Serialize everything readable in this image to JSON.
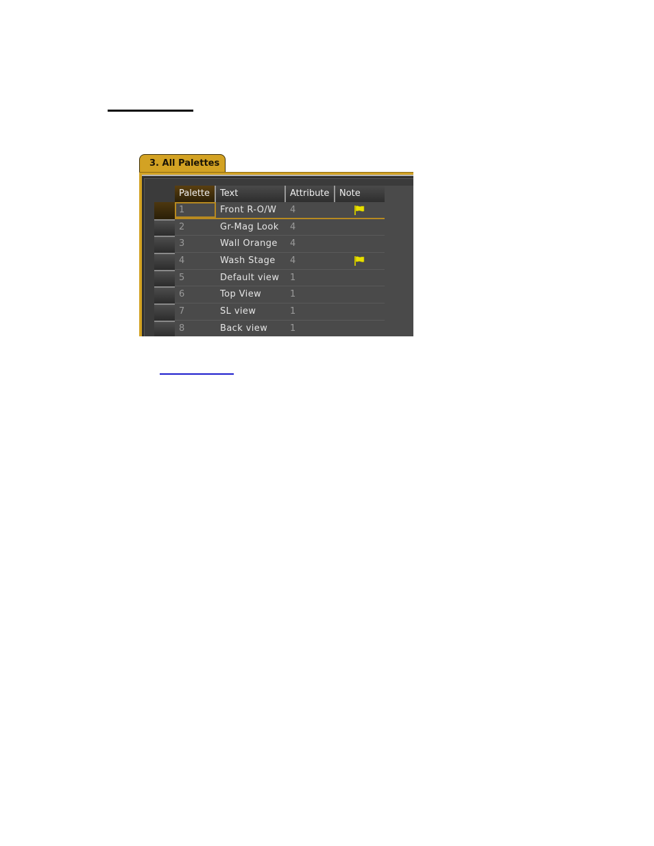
{
  "window": {
    "tab_label": "3. All Palettes"
  },
  "table": {
    "columns": [
      "Palette",
      "Text",
      "Attribute",
      "Note"
    ],
    "rows": [
      {
        "palette": "1",
        "text": "Front R-O/W",
        "attribute": "4",
        "note_icon": "flag-icon",
        "selected": true
      },
      {
        "palette": "2",
        "text": "Gr-Mag Look",
        "attribute": "4",
        "note_icon": null
      },
      {
        "palette": "3",
        "text": "Wall Orange",
        "attribute": "4",
        "note_icon": null
      },
      {
        "palette": "4",
        "text": "Wash Stage",
        "attribute": "4",
        "note_icon": "flag-icon"
      },
      {
        "palette": "5",
        "text": "Default view",
        "attribute": "1",
        "note_icon": null
      },
      {
        "palette": "6",
        "text": "Top View",
        "attribute": "1",
        "note_icon": null
      },
      {
        "palette": "7",
        "text": "SL view",
        "attribute": "1",
        "note_icon": null
      },
      {
        "palette": "8",
        "text": "Back view",
        "attribute": "1",
        "note_icon": null
      }
    ]
  },
  "colors": {
    "accent": "#d3a223",
    "flag": "#e8e000",
    "link": "#1a1acc"
  }
}
